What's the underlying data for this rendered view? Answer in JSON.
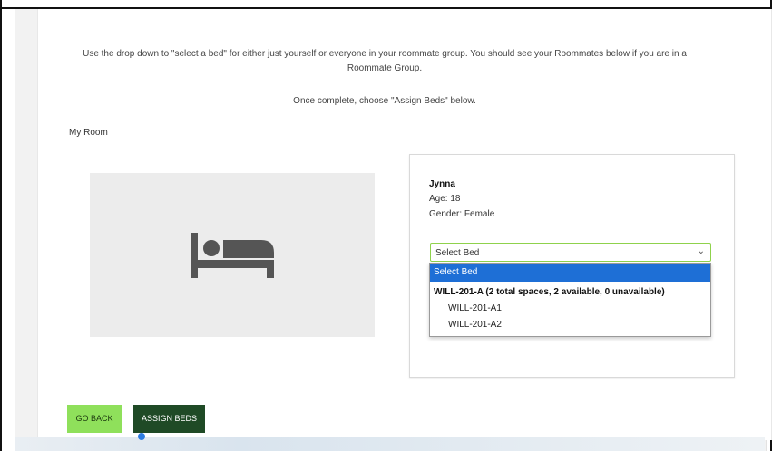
{
  "instructions": {
    "line1": "Use the drop down to \"select a bed\" for either just yourself or everyone in your roommate group. You should see your Roommates below if you are in a Roommate Group.",
    "line2": "Once complete, choose \"Assign Beds\" below."
  },
  "room": {
    "heading": "My Room",
    "image_icon": "bed-icon"
  },
  "student": {
    "name": "Jynna",
    "age": "Age: 18",
    "gender": "Gender: Female"
  },
  "bed_select": {
    "value": "Select Bed",
    "options": {
      "selected": "Select Bed",
      "group_label": "WILL-201-A (2 total spaces, 2 available, 0 unavailable)",
      "items": [
        "WILL-201-A1",
        "WILL-201-A2"
      ]
    }
  },
  "buttons": {
    "back": "GO BACK",
    "assign": "ASSIGN BEDS"
  },
  "colors": {
    "back_button": "#8fe05b",
    "assign_button": "#1f4a26",
    "select_border": "#8fd24c",
    "dropdown_highlight": "#1e6fd6"
  }
}
